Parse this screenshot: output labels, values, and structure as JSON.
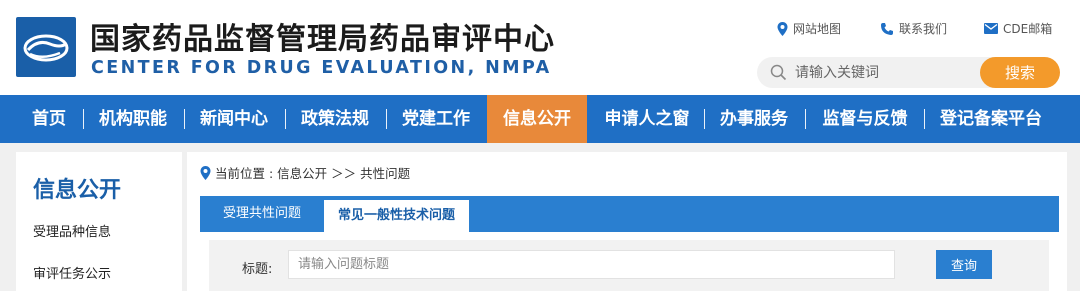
{
  "header": {
    "title_cn": "国家药品监督管理局药品审评中心",
    "title_en": "CENTER FOR DRUG EVALUATION, NMPA",
    "links": [
      {
        "label": "网站地图",
        "icon": "map-pin-icon"
      },
      {
        "label": "联系我们",
        "icon": "phone-icon"
      },
      {
        "label": "CDE邮箱",
        "icon": "mail-icon"
      }
    ],
    "search": {
      "placeholder": "请输入关键词",
      "button": "搜索"
    }
  },
  "nav": {
    "items": [
      "首页",
      "机构职能",
      "新闻中心",
      "政策法规",
      "党建工作",
      "信息公开",
      "申请人之窗",
      "办事服务",
      "监督与反馈",
      "登记备案平台"
    ],
    "active": "信息公开"
  },
  "sidebar": {
    "title": "信息公开",
    "items": [
      "受理品种信息",
      "审评任务公示"
    ]
  },
  "content": {
    "breadcrumb": "当前位置 : 信息公开 ＞＞ 共性问题",
    "tabs": [
      "受理共性问题",
      "常见一般性技术问题"
    ],
    "active_tab": "常见一般性技术问题",
    "filter": {
      "label": "标题:",
      "placeholder": "请输入问题标题",
      "button": "查询"
    }
  },
  "colors": {
    "brand_blue": "#1f6fc5",
    "accent_orange": "#e8893a",
    "search_orange": "#f39a2b"
  }
}
